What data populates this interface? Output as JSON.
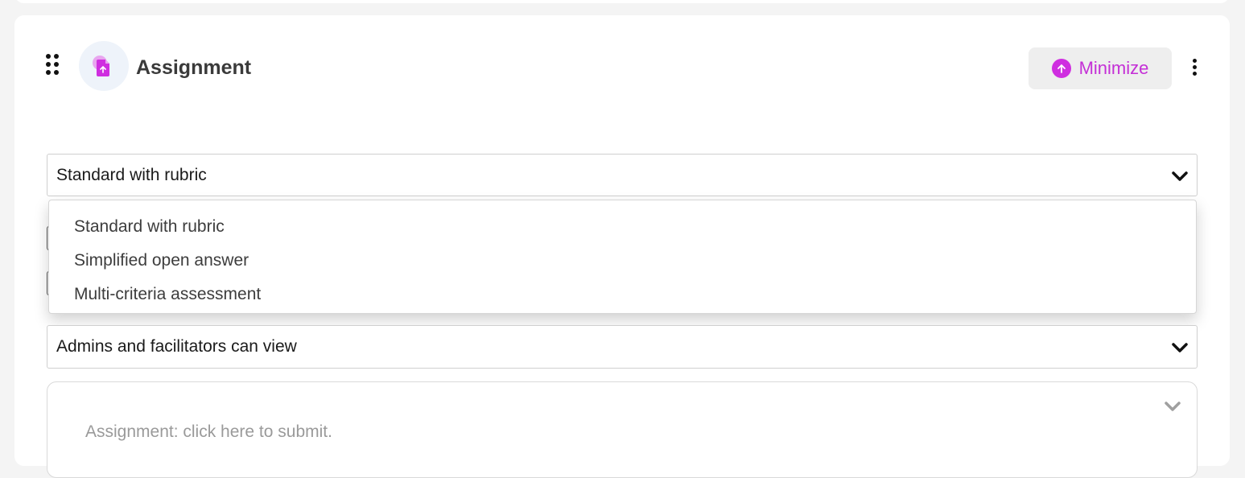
{
  "block": {
    "title": "Assignment",
    "icon": "assignment-upload-icon",
    "accent_color": "#cf2ee0"
  },
  "header": {
    "minimize_label": "Minimize",
    "minimize_icon": "arrow-up-circle-icon",
    "more_icon": "vertical-dots-icon",
    "drag_icon": "drag-handle-icon"
  },
  "assignment_type": {
    "selected": "Standard with rubric",
    "options": [
      "Standard with rubric",
      "Simplified open answer",
      "Multi-criteria assessment"
    ]
  },
  "visibility": {
    "selected": "Admins and facilitators can view"
  },
  "submission": {
    "placeholder": "Assignment: click here to submit."
  }
}
